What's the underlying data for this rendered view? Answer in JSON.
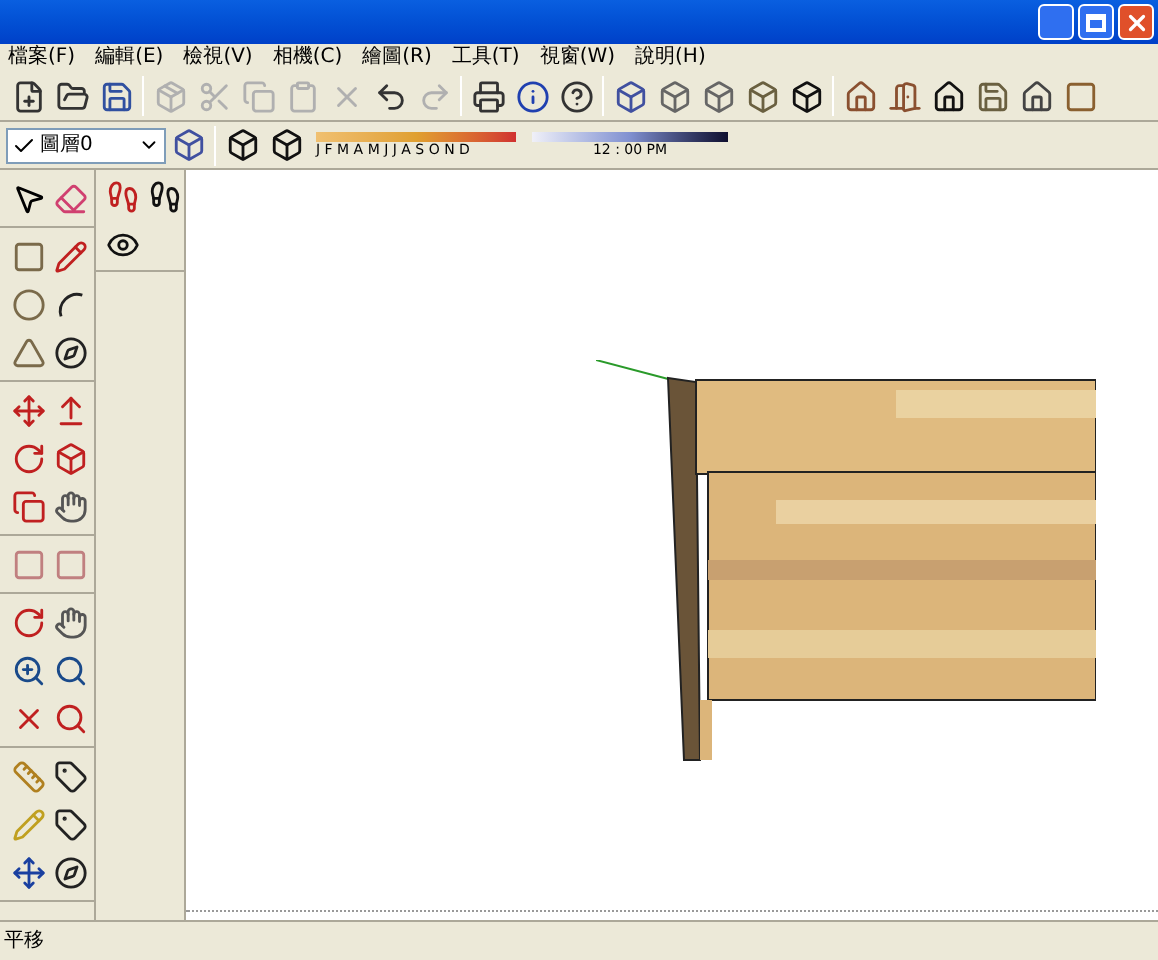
{
  "menu": [
    {
      "label": "檔案(F)"
    },
    {
      "label": "編輯(E)"
    },
    {
      "label": "檢視(V)"
    },
    {
      "label": "相機(C)"
    },
    {
      "label": "繪圖(R)"
    },
    {
      "label": "工具(T)"
    },
    {
      "label": "視窗(W)"
    },
    {
      "label": "說明(H)"
    }
  ],
  "standard_toolbar": [
    {
      "kind": "new",
      "disabled": false
    },
    {
      "kind": "open",
      "disabled": false
    },
    {
      "kind": "save",
      "disabled": false
    },
    {
      "kind": "component",
      "disabled": true
    },
    {
      "kind": "cut",
      "disabled": true
    },
    {
      "kind": "copy",
      "disabled": true
    },
    {
      "kind": "paste",
      "disabled": true
    },
    {
      "kind": "delete",
      "disabled": true
    },
    {
      "kind": "undo",
      "disabled": false
    },
    {
      "kind": "redo",
      "disabled": true
    },
    {
      "kind": "print",
      "disabled": false
    },
    {
      "kind": "info",
      "disabled": false
    },
    {
      "kind": "help",
      "disabled": false
    }
  ],
  "layer": {
    "value": "圖層0"
  },
  "shadow": {
    "months": "J F M A M J J A S O N D",
    "time": "12 : 00 PM"
  },
  "status_bar": {
    "text": "平移"
  }
}
